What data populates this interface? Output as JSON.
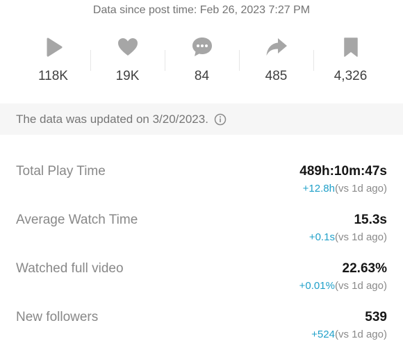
{
  "header": {
    "since_text": "Data since post time: Feb 26, 2023 7:27 PM"
  },
  "stats": [
    {
      "icon": "play-icon",
      "value": "118K"
    },
    {
      "icon": "heart-icon",
      "value": "19K"
    },
    {
      "icon": "comment-icon",
      "value": "84"
    },
    {
      "icon": "share-icon",
      "value": "485"
    },
    {
      "icon": "bookmark-icon",
      "value": "4,326"
    }
  ],
  "banner": {
    "text": "The data was updated on 3/20/2023.",
    "icon": "info-icon"
  },
  "metrics": [
    {
      "label": "Total Play Time",
      "value": "489h:10m:47s",
      "delta": "+12.8h",
      "compare": "(vs 1d ago)"
    },
    {
      "label": "Average Watch Time",
      "value": "15.3s",
      "delta": "+0.1s",
      "compare": "(vs 1d ago)"
    },
    {
      "label": "Watched full video",
      "value": "22.63%",
      "delta": "+0.01%",
      "compare": "(vs 1d ago)"
    },
    {
      "label": "New followers",
      "value": "539",
      "delta": "+524",
      "compare": "(vs 1d ago)"
    }
  ],
  "colors": {
    "icon_gray": "#a6a6a6",
    "delta_blue": "#20a0c9",
    "banner_bg": "#f6f6f6"
  }
}
